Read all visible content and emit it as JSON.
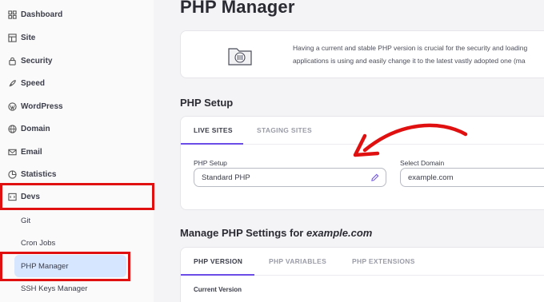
{
  "sidebar": {
    "items": [
      {
        "label": "Dashboard",
        "icon": "dashboard-icon"
      },
      {
        "label": "Site",
        "icon": "site-icon"
      },
      {
        "label": "Security",
        "icon": "lock-icon"
      },
      {
        "label": "Speed",
        "icon": "rocket-icon"
      },
      {
        "label": "WordPress",
        "icon": "wordpress-icon"
      },
      {
        "label": "Domain",
        "icon": "globe-icon"
      },
      {
        "label": "Email",
        "icon": "mail-icon"
      },
      {
        "label": "Statistics",
        "icon": "pie-chart-icon"
      },
      {
        "label": "Devs",
        "icon": "code-icon"
      }
    ],
    "sub_items": [
      {
        "label": "Git"
      },
      {
        "label": "Cron Jobs"
      },
      {
        "label": "PHP Manager",
        "active": true
      },
      {
        "label": "SSH Keys Manager"
      }
    ]
  },
  "page": {
    "title": "PHP Manager",
    "info_line1": "Having a current and stable PHP version is crucial for the security and loading",
    "info_line2": "applications is using and easily change it to the latest vastly adopted one (ma"
  },
  "php_setup": {
    "title": "PHP Setup",
    "tabs": [
      "LIVE SITES",
      "STAGING SITES"
    ],
    "setup_label": "PHP Setup",
    "setup_value": "Standard PHP",
    "domain_label": "Select Domain",
    "domain_value": "example.com"
  },
  "manage": {
    "title_prefix": "Manage PHP Settings for ",
    "title_domain": "example.com",
    "tabs": [
      "PHP VERSION",
      "PHP VARIABLES",
      "PHP EXTENSIONS"
    ],
    "current_version_label": "Current Version"
  },
  "colors": {
    "accent": "#6b4ce6",
    "highlight": "#e01010",
    "active_bg": "#d6e6ff"
  }
}
